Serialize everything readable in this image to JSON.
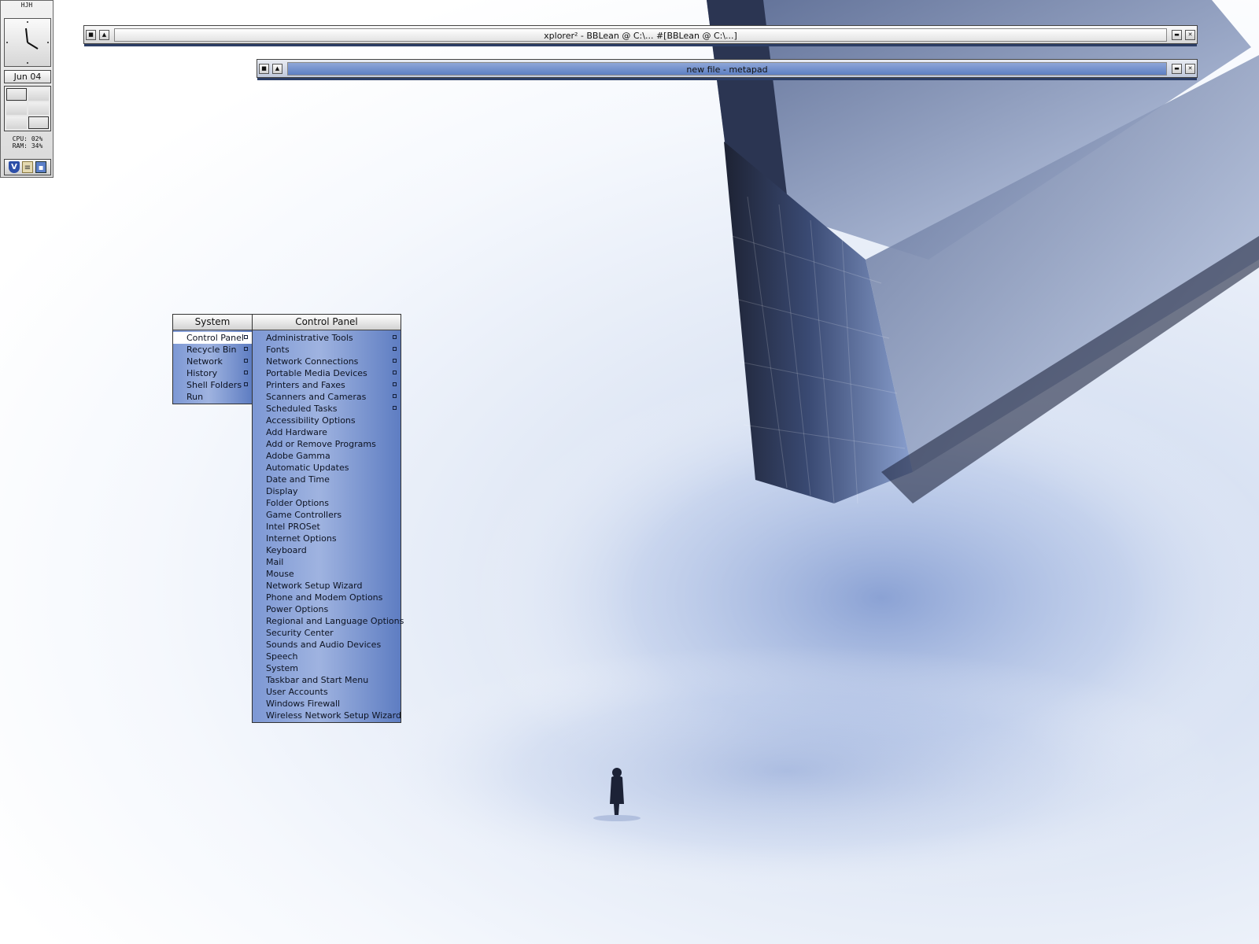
{
  "slit": {
    "label": "HJH",
    "date": "Jun 04",
    "cpu_text": "CPU: 02%",
    "ram_text": "RAM: 34%",
    "tray_icons": [
      "shield-icon",
      "clipboard-icon",
      "network-icon"
    ]
  },
  "windows": [
    {
      "title": "xplorer² - BBLean @ C:\\... #[BBLean @ C:\\...]",
      "active": false
    },
    {
      "title": "new file - metapad",
      "active": true
    }
  ],
  "system_menu": {
    "title": "System",
    "items": [
      {
        "label": "Control Panel",
        "submenu": true,
        "selected": true
      },
      {
        "label": "Recycle Bin",
        "submenu": true
      },
      {
        "label": "Network",
        "submenu": true
      },
      {
        "label": "History",
        "submenu": true
      },
      {
        "label": "Shell Folders",
        "submenu": true
      },
      {
        "label": "Run",
        "submenu": false
      }
    ]
  },
  "control_panel_menu": {
    "title": "Control Panel",
    "items": [
      {
        "label": "Administrative Tools",
        "submenu": true
      },
      {
        "label": "Fonts",
        "submenu": true
      },
      {
        "label": "Network Connections",
        "submenu": true
      },
      {
        "label": "Portable Media Devices",
        "submenu": true
      },
      {
        "label": "Printers and Faxes",
        "submenu": true
      },
      {
        "label": "Scanners and Cameras",
        "submenu": true
      },
      {
        "label": "Scheduled Tasks",
        "submenu": true
      },
      {
        "label": "Accessibility Options",
        "submenu": false
      },
      {
        "label": "Add Hardware",
        "submenu": false
      },
      {
        "label": "Add or Remove Programs",
        "submenu": false
      },
      {
        "label": "Adobe Gamma",
        "submenu": false
      },
      {
        "label": "Automatic Updates",
        "submenu": false
      },
      {
        "label": "Date and Time",
        "submenu": false
      },
      {
        "label": "Display",
        "submenu": false
      },
      {
        "label": "Folder Options",
        "submenu": false
      },
      {
        "label": "Game Controllers",
        "submenu": false
      },
      {
        "label": "Intel PROSet",
        "submenu": false
      },
      {
        "label": "Internet Options",
        "submenu": false
      },
      {
        "label": "Keyboard",
        "submenu": false
      },
      {
        "label": "Mail",
        "submenu": false
      },
      {
        "label": "Mouse",
        "submenu": false
      },
      {
        "label": "Network Setup Wizard",
        "submenu": false
      },
      {
        "label": "Phone and Modem Options",
        "submenu": false
      },
      {
        "label": "Power Options",
        "submenu": false
      },
      {
        "label": "Regional and Language Options",
        "submenu": false
      },
      {
        "label": "Security Center",
        "submenu": false
      },
      {
        "label": "Sounds and Audio Devices",
        "submenu": false
      },
      {
        "label": "Speech",
        "submenu": false
      },
      {
        "label": "System",
        "submenu": false
      },
      {
        "label": "Taskbar and Start Menu",
        "submenu": false
      },
      {
        "label": "User Accounts",
        "submenu": false
      },
      {
        "label": "Windows Firewall",
        "submenu": false
      },
      {
        "label": "Wireless Network Setup Wizard",
        "submenu": false
      }
    ]
  },
  "colors": {
    "menu_gradient": "#7d98d4",
    "selected_item": "#ffffff",
    "wallpaper_tint": "#c9d6ee"
  }
}
